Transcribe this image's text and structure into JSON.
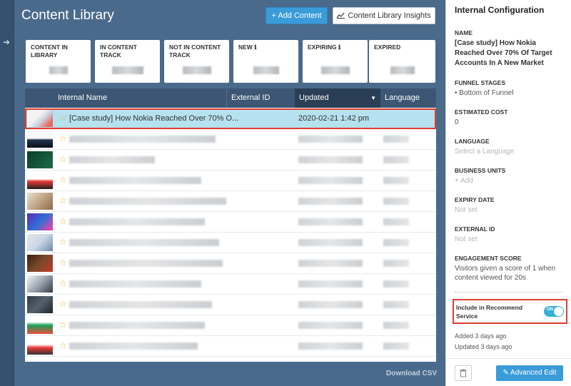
{
  "header": {
    "title": "Content Library",
    "add_label": "+ Add Content",
    "insights_label": "Content Library Insights"
  },
  "stats": [
    {
      "label": "CONTENT IN LIBRARY",
      "info": false
    },
    {
      "label": "IN CONTENT TRACK",
      "info": false
    },
    {
      "label": "NOT IN CONTENT TRACK",
      "info": false
    },
    {
      "label": "NEW",
      "info": true
    },
    {
      "label": "EXPIRING",
      "info": true
    },
    {
      "label": "EXPIRED",
      "info": false
    }
  ],
  "table": {
    "columns": [
      "Internal Name",
      "External ID",
      "Updated",
      "Language"
    ],
    "selected_row": {
      "name": "[Case study] How Nokia Reached Over 70% O...",
      "updated": "2020-02-21 1:42 pm"
    }
  },
  "footer": {
    "download_label": "Download CSV"
  },
  "panel": {
    "title": "Internal Configuration",
    "name_label": "NAME",
    "name_value": "[Case study] How Nokia Reached Over 70% Of Target Accounts In A New Market",
    "funnel_label": "FUNNEL STAGES",
    "funnel_value": "• Bottom of Funnel",
    "cost_label": "ESTIMATED COST",
    "cost_value": "0",
    "language_label": "LANGUAGE",
    "language_value": "Select a Language",
    "bu_label": "BUSINESS UNITS",
    "bu_value": "+ Add",
    "expiry_label": "EXPIRY DATE",
    "expiry_value": "Not set",
    "extid_label": "EXTERNAL ID",
    "extid_value": "Not set",
    "engagement_label": "ENGAGEMENT SCORE",
    "engagement_value": "Visitors given a score of 1 when content viewed for 20s",
    "recommend_label": "Include in Recommend Service",
    "toggle_text": "ON",
    "added": "Added 3 days ago",
    "updated": "Updated 3 days ago",
    "edit_label": "Advanced Edit"
  },
  "colors": {
    "accent": "#3a9bd9",
    "highlight": "#e03c2e",
    "selected_row": "#b6e1ef",
    "toggle_on": "#35b0d6"
  }
}
